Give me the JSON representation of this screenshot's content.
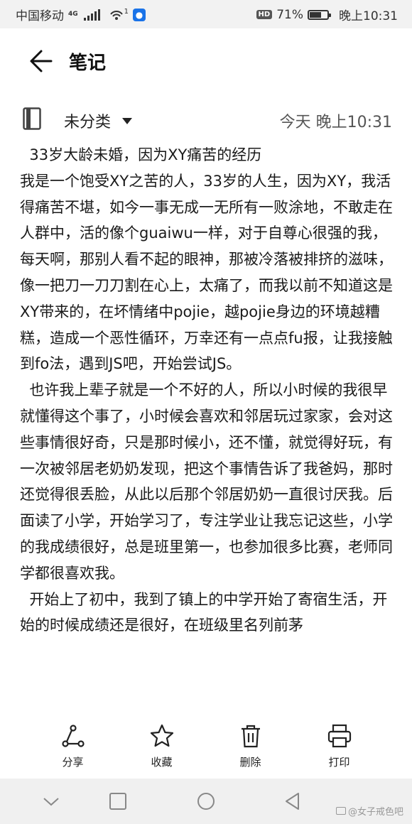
{
  "status_bar": {
    "carrier": "中国移动",
    "network": "4G",
    "hotspot_count": "1",
    "hd_badge": "HD",
    "battery": "71%",
    "battery_level": 0.71,
    "time": "晚上10:31"
  },
  "header": {
    "title": "笔记",
    "back_icon": "arrow-left-icon"
  },
  "meta": {
    "category": "未分类",
    "timestamp": "今天 晚上10:31"
  },
  "note": {
    "paragraphs": [
      "  33岁大龄未婚，因为XY痛苦的经历",
      "我是一个饱受XY之苦的人，33岁的人生，因为XY，我活得痛苦不堪，如今一事无成一无所有一败涂地，不敢走在人群中，活的像个guaiwu一样，对于自尊心很强的我，每天啊，那别人看不起的眼神，那被冷落被排挤的滋味，像一把刀一刀刀割在心上，太痛了，而我以前不知道这是XY带来的，在坏情绪中pojie，越pojie身边的环境越糟糕，造成一个恶性循环，万幸还有一点点fu报，让我接触到fo法，遇到JS吧，开始尝试JS。",
      "  也许我上辈子就是一个不好的人，所以小时候的我很早就懂得这个事了，小时候会喜欢和邻居玩过家家，会对这些事情很好奇，只是那时候小，还不懂，就觉得好玩，有一次被邻居老奶奶发现，把这个事情告诉了我爸妈，那时还觉得很丢脸，从此以后那个邻居奶奶一直很讨厌我。后面读了小学，开始学习了，专注学业让我忘记这些，小学的我成绩很好，总是班里第一，也参加很多比赛，老师同学都很喜欢我。",
      "  开始上了初中，我到了镇上的中学开始了寄宿生活，开始的时候成绩还是很好，在班级里名列前茅"
    ]
  },
  "toolbar": {
    "share": "分享",
    "favorite": "收藏",
    "delete": "删除",
    "print": "打印"
  },
  "nav": {
    "watermark": "@女子戒色吧"
  }
}
